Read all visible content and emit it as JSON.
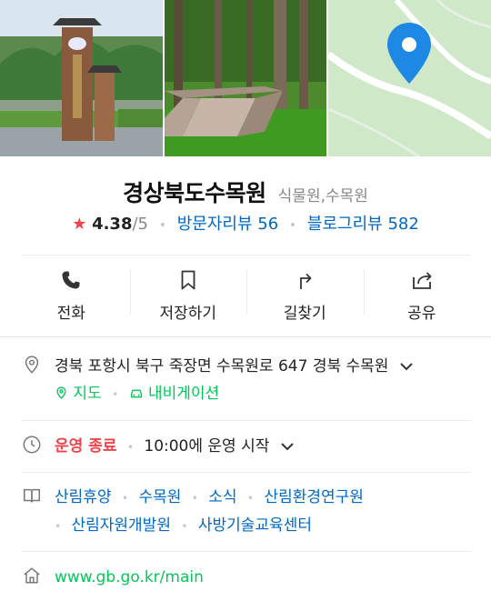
{
  "place": {
    "name": "경상북도수목원",
    "category": "식물원,수목원"
  },
  "rating": {
    "star": "★",
    "score": "4.38",
    "max": "/5",
    "visitor_reviews": "방문자리뷰 56",
    "blog_reviews": "블로그리뷰 582"
  },
  "actions": {
    "call": "전화",
    "save": "저장하기",
    "directions": "길찾기",
    "share": "공유"
  },
  "address": {
    "text": "경북 포항시 북구 죽장면 수목원로 647 경북 수목원",
    "map_link": "지도",
    "navigation_link": "내비게이션"
  },
  "hours": {
    "status": "운영 종료",
    "next": "10:00에 운영 시작"
  },
  "tags": {
    "items": [
      "산림휴양",
      "수목원",
      "소식",
      "산림환경연구원",
      "산림자원개발원",
      "사방기술교육센터"
    ]
  },
  "website": {
    "url": "www.gb.go.kr/main"
  },
  "colors": {
    "accent_green": "#03c75a",
    "link_blue": "#0068c3",
    "status_red": "#f0444b",
    "map_pin": "#1e88e5"
  },
  "icons": {
    "call": "phone-icon",
    "save": "bookmark-icon",
    "directions": "turn-arrow-icon",
    "share": "share-icon",
    "address": "location-pin-icon",
    "hours": "clock-icon",
    "tags": "book-icon",
    "website": "home-icon"
  }
}
